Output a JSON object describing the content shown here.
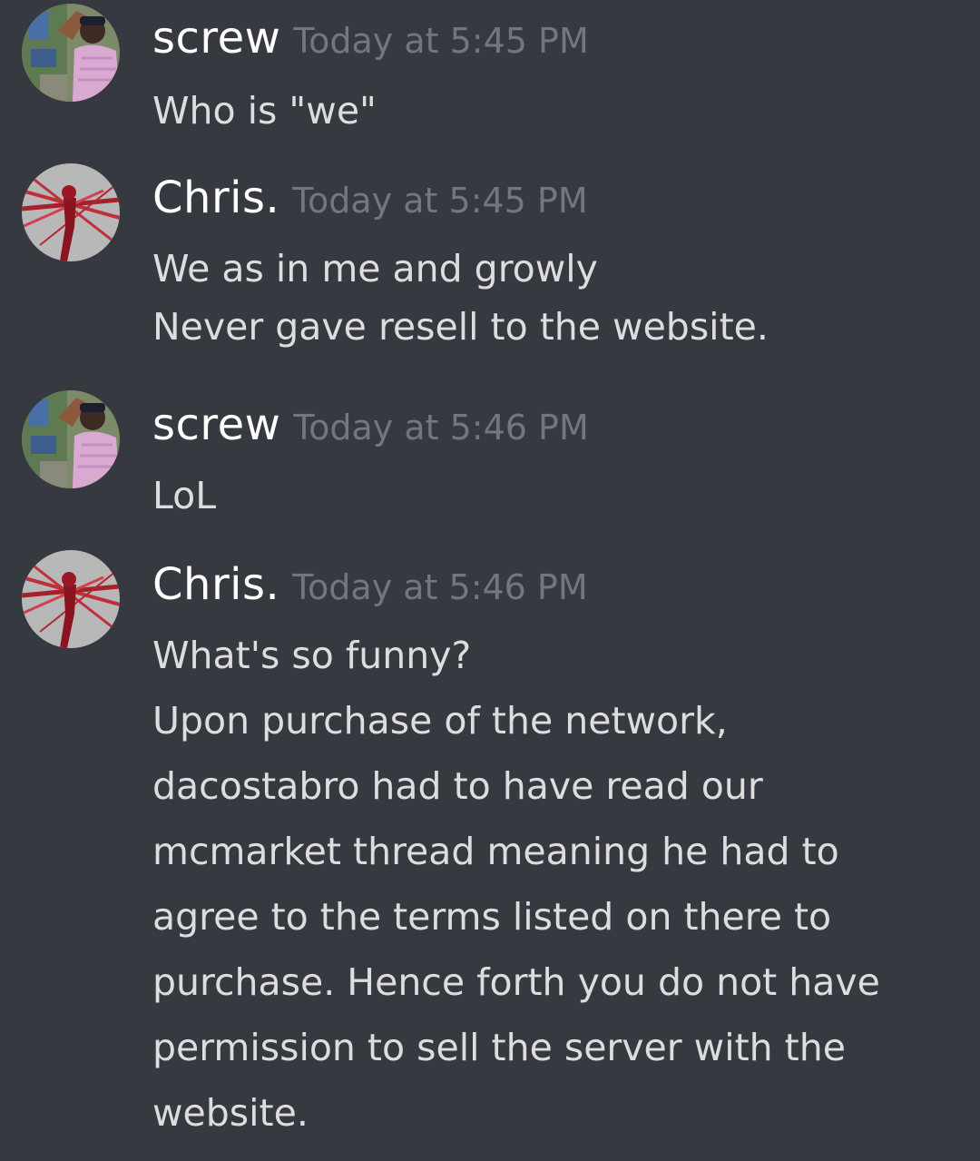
{
  "messages": [
    {
      "author": "screw",
      "timestamp": "Today at 5:45 PM",
      "avatar_icon": "user-avatar-screw",
      "lines": [
        "Who is \"we\""
      ]
    },
    {
      "author": "Chris.",
      "timestamp": "Today at 5:45 PM",
      "avatar_icon": "user-avatar-chris",
      "lines": [
        "We as in me and growly",
        "Never gave resell to the website."
      ]
    },
    {
      "author": "screw",
      "timestamp": "Today at 5:46 PM",
      "avatar_icon": "user-avatar-screw",
      "lines": [
        "LoL"
      ]
    },
    {
      "author": "Chris.",
      "timestamp": "Today at 5:46 PM",
      "avatar_icon": "user-avatar-chris",
      "lines": [
        "What's so funny?",
        "Upon purchase of the network,",
        "dacostabro had to have read our",
        "mcmarket thread meaning he had to",
        "agree to the terms listed on there to",
        "purchase. Hence forth you do not have",
        "permission to sell the server with the",
        "website."
      ]
    }
  ],
  "colors": {
    "background": "#36393f",
    "author": "#ffffff",
    "timestamp": "#72767d",
    "text": "#dcddde"
  }
}
